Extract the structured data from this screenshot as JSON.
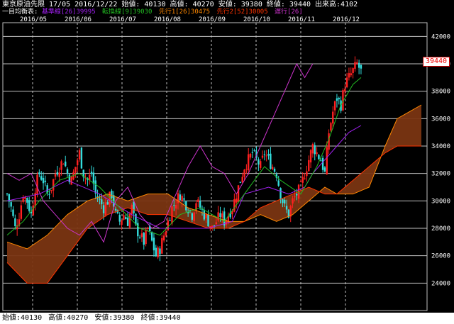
{
  "header": {
    "line1": "東京原油先限  17/05  2016/12/22  始値: 40130  高値: 40270  安値: 39380  終値: 39440  出来高:4102",
    "ichimoku_label": "一目均衡表:",
    "legend": [
      {
        "text": "基準線[26]39995",
        "color": "#a020f0"
      },
      {
        "text": "転換線[9]39030",
        "color": "#22bb22"
      },
      {
        "text": "先行1[26]30475",
        "color": "#ff8800"
      },
      {
        "text": "先行2[52]30005",
        "color": "#ff3300"
      },
      {
        "text": "遅行[26]",
        "color": "#cc33cc"
      }
    ]
  },
  "footer": {
    "open": "始値:40130",
    "high": "高値:40270",
    "low": "安値:39380",
    "close": "終値:39440"
  },
  "price_badge": "39440",
  "colors": {
    "background": "#000000",
    "grid": "#c0c0c0",
    "up_candle": "#ff2020",
    "down_candle": "#33dddd",
    "kijun": "#a020f0",
    "tenkan": "#22bb22",
    "span_a": "#ff8800",
    "span_b": "#ff3300",
    "cloud_fill": "#7a3512",
    "chikou": "#cc33cc"
  },
  "chart_data": {
    "type": "candlestick",
    "title": "東京原油先限 17/05",
    "x": [
      "2016/05",
      "2016/06",
      "2016/07",
      "2016/08",
      "2016/09",
      "2016/10",
      "2016/11",
      "2016/12"
    ],
    "y_ticks": [
      24000,
      26000,
      28000,
      30000,
      32000,
      34000,
      36000,
      38000,
      40000,
      42000
    ],
    "ylim": [
      22000,
      43000
    ],
    "grid": true,
    "last_price": 39440,
    "ohlc_last": {
      "open": 40130,
      "high": 40270,
      "low": 39380,
      "close": 39440,
      "volume": 4102
    },
    "close_path": [
      [
        0,
        30500
      ],
      [
        2,
        29500
      ],
      [
        4,
        28000
      ],
      [
        6,
        29000
      ],
      [
        8,
        30500
      ],
      [
        10,
        30000
      ],
      [
        12,
        29000
      ],
      [
        14,
        31000
      ],
      [
        16,
        32000
      ],
      [
        18,
        31500
      ],
      [
        20,
        30500
      ],
      [
        22,
        31000
      ],
      [
        24,
        32000
      ],
      [
        26,
        32500
      ],
      [
        28,
        33000
      ],
      [
        30,
        32000
      ],
      [
        32,
        31500
      ],
      [
        34,
        32500
      ],
      [
        36,
        33500
      ],
      [
        38,
        32000
      ],
      [
        40,
        31500
      ],
      [
        42,
        32000
      ],
      [
        44,
        30500
      ],
      [
        46,
        30000
      ],
      [
        48,
        29500
      ],
      [
        50,
        30000
      ],
      [
        52,
        30500
      ],
      [
        54,
        29000
      ],
      [
        56,
        28500
      ],
      [
        58,
        29000
      ],
      [
        60,
        28500
      ],
      [
        62,
        29500
      ],
      [
        64,
        28000
      ],
      [
        66,
        27500
      ],
      [
        68,
        27000
      ],
      [
        70,
        28000
      ],
      [
        72,
        27000
      ],
      [
        74,
        26000
      ],
      [
        76,
        26500
      ],
      [
        78,
        27500
      ],
      [
        80,
        28500
      ],
      [
        82,
        29500
      ],
      [
        84,
        30000
      ],
      [
        86,
        30500
      ],
      [
        88,
        30000
      ],
      [
        90,
        29500
      ],
      [
        92,
        29000
      ],
      [
        94,
        30000
      ],
      [
        96,
        29500
      ],
      [
        98,
        29000
      ],
      [
        100,
        28500
      ],
      [
        102,
        28000
      ],
      [
        104,
        28500
      ],
      [
        106,
        29000
      ],
      [
        108,
        28500
      ],
      [
        110,
        29000
      ],
      [
        112,
        29500
      ],
      [
        114,
        30500
      ],
      [
        116,
        31500
      ],
      [
        118,
        32500
      ],
      [
        120,
        33000
      ],
      [
        122,
        33500
      ],
      [
        124,
        33000
      ],
      [
        126,
        32500
      ],
      [
        128,
        33500
      ],
      [
        130,
        33000
      ],
      [
        132,
        32500
      ],
      [
        134,
        32000
      ],
      [
        136,
        30500
      ],
      [
        138,
        29500
      ],
      [
        140,
        29000
      ],
      [
        142,
        30000
      ],
      [
        144,
        30500
      ],
      [
        146,
        31000
      ],
      [
        148,
        32000
      ],
      [
        150,
        33000
      ],
      [
        152,
        34000
      ],
      [
        154,
        33500
      ],
      [
        156,
        33000
      ],
      [
        158,
        32000
      ],
      [
        160,
        35000
      ],
      [
        162,
        36500
      ],
      [
        164,
        37500
      ],
      [
        166,
        37000
      ],
      [
        168,
        38500
      ],
      [
        170,
        39000
      ],
      [
        172,
        39500
      ],
      [
        174,
        40000
      ],
      [
        176,
        39440
      ]
    ],
    "kijun_path": [
      [
        0,
        30000
      ],
      [
        16,
        30500
      ],
      [
        30,
        31500
      ],
      [
        46,
        30500
      ],
      [
        62,
        29000
      ],
      [
        76,
        28000
      ],
      [
        100,
        28000
      ],
      [
        112,
        28500
      ],
      [
        118,
        30500
      ],
      [
        130,
        31000
      ],
      [
        140,
        30500
      ],
      [
        148,
        31000
      ],
      [
        152,
        32000
      ],
      [
        158,
        33000
      ],
      [
        164,
        34000
      ],
      [
        170,
        35000
      ],
      [
        176,
        35500
      ]
    ],
    "tenkan_path": [
      [
        0,
        27500
      ],
      [
        8,
        28500
      ],
      [
        16,
        30000
      ],
      [
        26,
        31500
      ],
      [
        36,
        32000
      ],
      [
        46,
        31000
      ],
      [
        56,
        29500
      ],
      [
        66,
        28000
      ],
      [
        76,
        27500
      ],
      [
        86,
        29000
      ],
      [
        96,
        29500
      ],
      [
        108,
        28500
      ],
      [
        118,
        30500
      ],
      [
        128,
        32500
      ],
      [
        136,
        31500
      ],
      [
        146,
        30500
      ],
      [
        154,
        32500
      ],
      [
        160,
        34500
      ],
      [
        166,
        37000
      ],
      [
        172,
        38500
      ],
      [
        176,
        39000
      ]
    ],
    "span_a_path": [
      [
        0,
        27000
      ],
      [
        10,
        26500
      ],
      [
        20,
        27500
      ],
      [
        30,
        29000
      ],
      [
        40,
        30000
      ],
      [
        50,
        30500
      ],
      [
        60,
        30000
      ],
      [
        70,
        30500
      ],
      [
        80,
        30500
      ],
      [
        90,
        29500
      ],
      [
        100,
        29000
      ],
      [
        110,
        28500
      ],
      [
        118,
        28500
      ],
      [
        126,
        29000
      ],
      [
        134,
        28500
      ],
      [
        142,
        29000
      ],
      [
        150,
        30000
      ],
      [
        158,
        31000
      ],
      [
        164,
        30500
      ],
      [
        172,
        30500
      ],
      [
        180,
        31000
      ],
      [
        188,
        34000
      ],
      [
        194,
        36000
      ],
      [
        200,
        36500
      ],
      [
        206,
        37000
      ]
    ],
    "span_b_path": [
      [
        0,
        25500
      ],
      [
        10,
        24000
      ],
      [
        20,
        24000
      ],
      [
        30,
        26000
      ],
      [
        40,
        28000
      ],
      [
        50,
        29000
      ],
      [
        60,
        29500
      ],
      [
        70,
        29000
      ],
      [
        80,
        29000
      ],
      [
        90,
        28500
      ],
      [
        100,
        28000
      ],
      [
        110,
        28000
      ],
      [
        118,
        28500
      ],
      [
        126,
        29500
      ],
      [
        134,
        30000
      ],
      [
        142,
        30500
      ],
      [
        150,
        31000
      ],
      [
        158,
        30500
      ],
      [
        164,
        30500
      ],
      [
        172,
        31500
      ],
      [
        180,
        32500
      ],
      [
        188,
        33500
      ],
      [
        194,
        34000
      ],
      [
        200,
        34000
      ],
      [
        206,
        34000
      ]
    ],
    "chikou_path": [
      [
        0,
        32000
      ],
      [
        6,
        31500
      ],
      [
        12,
        32000
      ],
      [
        18,
        30000
      ],
      [
        24,
        29000
      ],
      [
        30,
        28000
      ],
      [
        36,
        27500
      ],
      [
        42,
        28500
      ],
      [
        48,
        27000
      ],
      [
        54,
        30000
      ],
      [
        60,
        31000
      ],
      [
        66,
        29000
      ],
      [
        72,
        28000
      ],
      [
        78,
        28500
      ],
      [
        84,
        30500
      ],
      [
        90,
        32500
      ],
      [
        96,
        34000
      ],
      [
        102,
        32500
      ],
      [
        108,
        32000
      ],
      [
        114,
        30500
      ],
      [
        120,
        32000
      ],
      [
        126,
        34000
      ],
      [
        132,
        36000
      ],
      [
        138,
        38000
      ],
      [
        144,
        40000
      ],
      [
        148,
        39000
      ],
      [
        152,
        40000
      ]
    ]
  }
}
